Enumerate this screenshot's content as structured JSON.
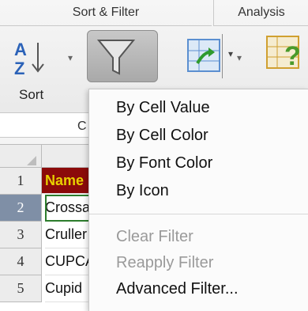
{
  "ribbon": {
    "groups": {
      "sort_filter": "Sort & Filter",
      "analysis": "Analysis"
    },
    "sort_label": "Sort",
    "sort_icon_glyphs": {
      "a": "A",
      "z": "Z"
    },
    "name_box_fragment": "C"
  },
  "filter_menu": {
    "items": [
      {
        "label": "By Cell Value",
        "enabled": true
      },
      {
        "label": "By Cell Color",
        "enabled": true
      },
      {
        "label": "By Font Color",
        "enabled": true
      },
      {
        "label": "By Icon",
        "enabled": true
      },
      {
        "label": "Clear Filter",
        "enabled": false
      },
      {
        "label": "Reapply Filter",
        "enabled": false
      },
      {
        "label": "Advanced Filter...",
        "enabled": true
      }
    ]
  },
  "sheet": {
    "rows": [
      {
        "num": "1",
        "value": "Name"
      },
      {
        "num": "2",
        "value": "Crossaint"
      },
      {
        "num": "3",
        "value": "Cruller"
      },
      {
        "num": "4",
        "value": "CUPCAKE"
      },
      {
        "num": "5",
        "value": "Cupid"
      }
    ]
  },
  "colors": {
    "header_fill": "#8b0a0a",
    "header_text": "#e8d000",
    "selected_row": "#7f8fa6"
  }
}
